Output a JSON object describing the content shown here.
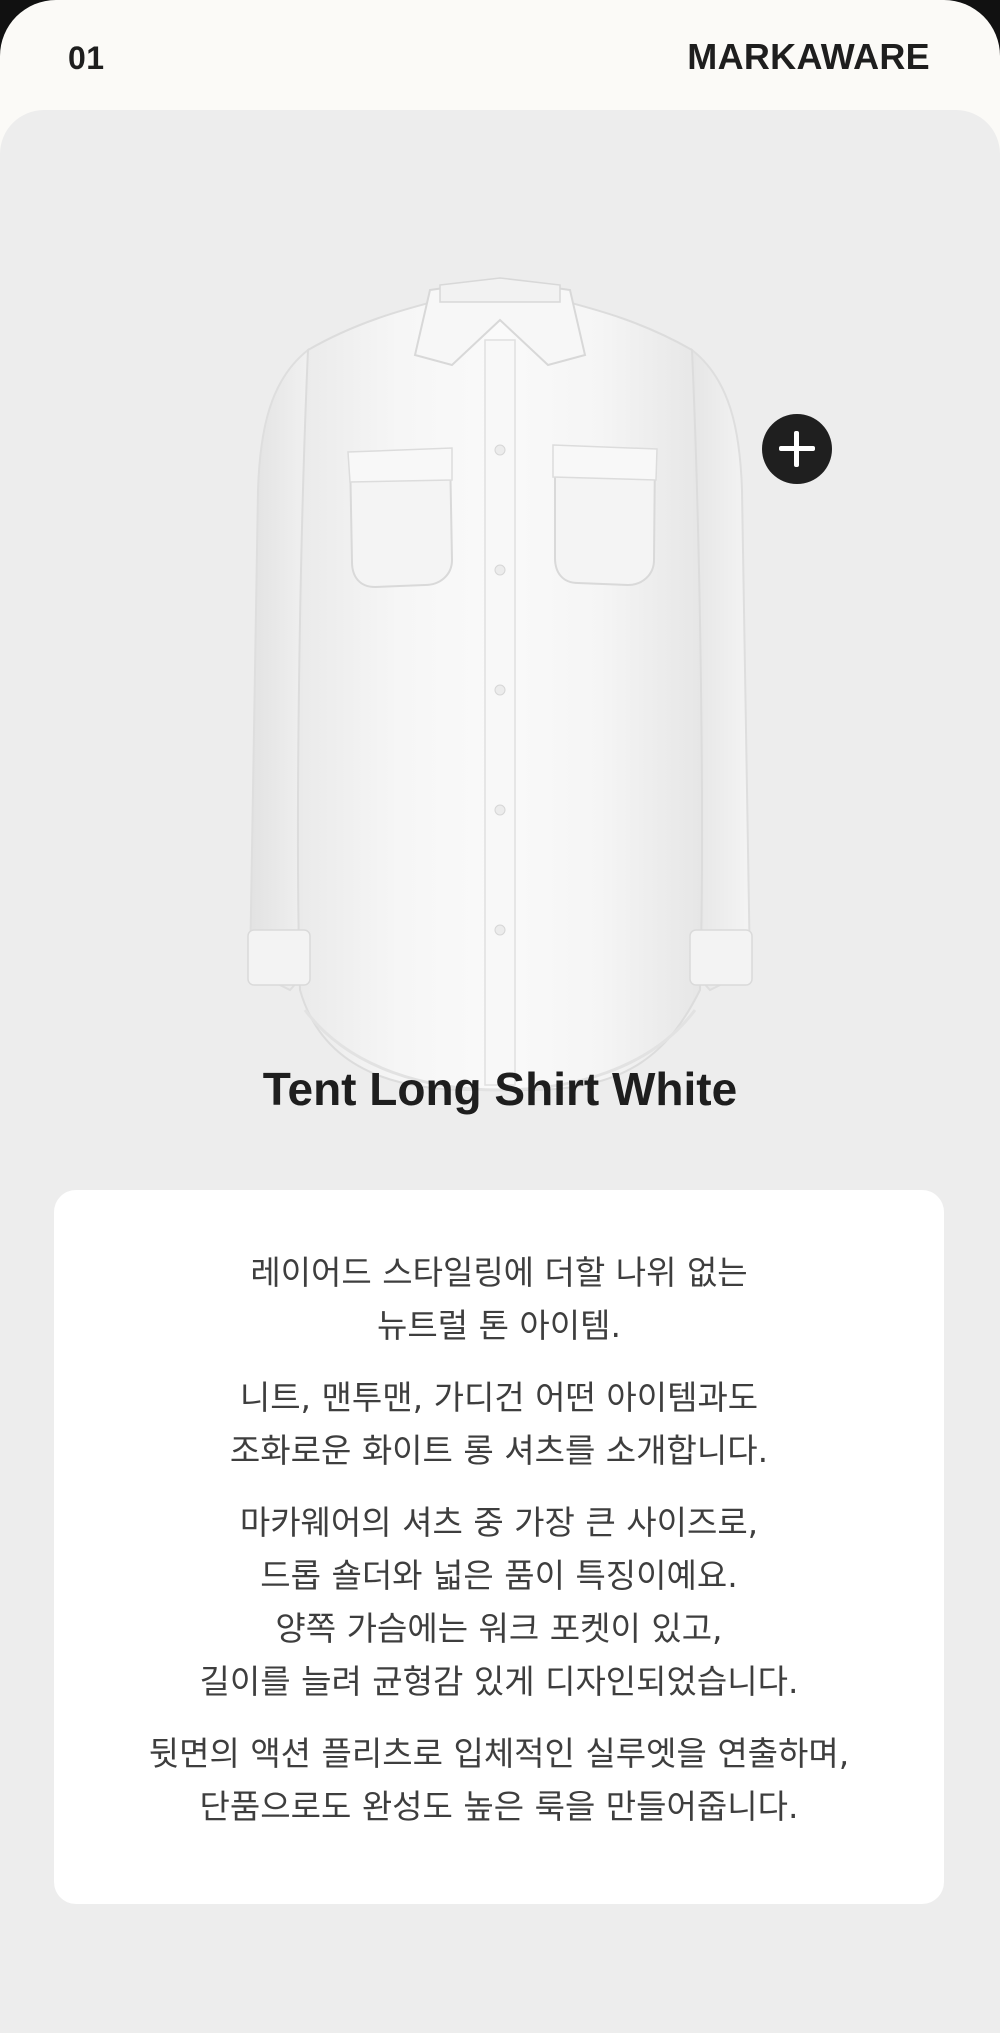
{
  "header": {
    "page_number": "01",
    "brand": "MARKAWARE"
  },
  "product": {
    "name": "Tent Long Shirt White",
    "image_icon": "white-long-shirt",
    "add_icon": "plus-icon"
  },
  "description": {
    "paragraphs": [
      [
        "레이어드 스타일링에 더할 나위 없는",
        "뉴트럴 톤 아이템."
      ],
      [
        "니트, 맨투맨, 가디건 어떤 아이템과도",
        "조화로운 화이트 롱 셔츠를 소개합니다."
      ],
      [
        "마카웨어의 셔츠 중 가장 큰 사이즈로,",
        "드롭 숄더와 넓은 품이 특징이예요.",
        "양쪽 가슴에는 워크 포켓이 있고,",
        "길이를 늘려 균형감 있게 디자인되었습니다."
      ],
      [
        "뒷면의 액션 플리츠로 입체적인 실루엣을 연출하며,",
        "단품으로도 완성도 높은 룩을 만들어줍니다."
      ]
    ]
  },
  "colors": {
    "background": "#ededed",
    "card": "#ffffff",
    "text": "#1e1e1e",
    "button": "#1f1f1f"
  }
}
